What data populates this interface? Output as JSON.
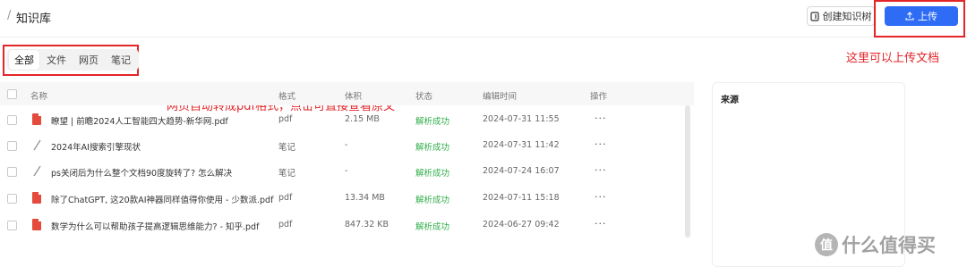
{
  "header": {
    "breadcrumb_sep": "/",
    "title": "知识库",
    "create_tree_label": "创建知识树",
    "upload_label": "上传"
  },
  "tabs": [
    {
      "label": "全部",
      "active": true
    },
    {
      "label": "文件",
      "active": false
    },
    {
      "label": "网页",
      "active": false
    },
    {
      "label": "笔记",
      "active": false
    }
  ],
  "table": {
    "columns": [
      "名称",
      "格式",
      "体积",
      "状态",
      "编辑时间",
      "操作"
    ],
    "rows": [
      {
        "icon": "pdf-icon",
        "name": "瞭望 | 前瞻2024人工智能四大趋势-新华网.pdf",
        "format": "pdf",
        "size": "2.15 MB",
        "status": "解析成功",
        "time": "2024-07-31 11:55",
        "action": "···"
      },
      {
        "icon": "note-icon",
        "name": "2024年AI搜索引擎现状",
        "format": "笔记",
        "size": "-",
        "status": "解析成功",
        "time": "2024-07-31 11:42",
        "action": "···"
      },
      {
        "icon": "note-icon",
        "name": "ps关闭后为什么整个文档90度旋转了? 怎么解决",
        "format": "笔记",
        "size": "-",
        "status": "解析成功",
        "time": "2024-07-24 16:07",
        "action": "···"
      },
      {
        "icon": "pdf-icon",
        "name": "除了ChatGPT, 这20款AI神器同样值得你使用 - 少数派.pdf",
        "format": "pdf",
        "size": "13.34 MB",
        "status": "解析成功",
        "time": "2024-07-11 15:18",
        "action": "···"
      },
      {
        "icon": "pdf-icon",
        "name": "数学为什么可以帮助孩子提高逻辑思维能力? - 知乎.pdf",
        "format": "pdf",
        "size": "847.32 KB",
        "status": "解析成功",
        "time": "2024-06-27 09:42",
        "action": "···"
      }
    ]
  },
  "side_panel": {
    "title": "来源"
  },
  "annotations": {
    "upload_note": "这里可以上传文档",
    "web_note": "网页自动转成pdf格式，点击可直接查看原文"
  },
  "watermark": {
    "glyph": "值",
    "text": "什么值得买"
  },
  "colors": {
    "primary": "#2f6cf6",
    "success": "#2fae4a",
    "annotation_red": "#e3252a",
    "pdf_red": "#e54b3c"
  }
}
